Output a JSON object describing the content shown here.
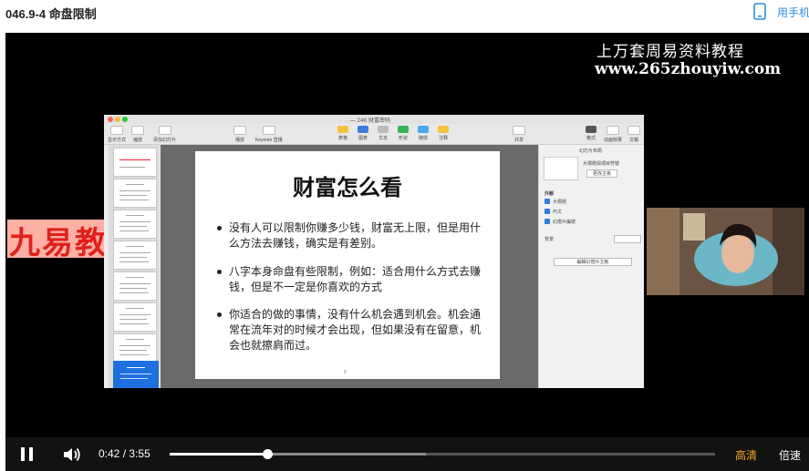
{
  "header": {
    "title": "046.9-4 命盘限制",
    "phone_label": "用手机"
  },
  "watermark": {
    "line1": "上万套周易资料教程",
    "line2": "www.265zhouyiw.com",
    "left_brand": "九易教程"
  },
  "keynote": {
    "window_title": "— 24K 财富密码",
    "toolbar": [
      "显示方式",
      "缩放",
      "添加幻灯片",
      "播放",
      "Keynote 直播",
      "表格",
      "图表",
      "文本",
      "形状",
      "媒体",
      "注释",
      "共享",
      "格式",
      "动画效果",
      "文稿"
    ],
    "slide": {
      "title": "财富怎么看",
      "bullets": [
        "没有人可以限制你赚多少钱，财富无上限，但是用什么方法去赚钱，确实是有差别。",
        "八字本身命盘有些限制，例如：适合用什么方式去赚钱，但是不一定是你喜欢的方式",
        "你适合的做的事情，没有什么机会遇到机会。机会通常在流年对的时候才会出现，但如果没有在留意，机会也就擦肩而过。"
      ],
      "page_number": "8"
    },
    "inspector": {
      "header": "幻灯片布局",
      "layout_name": "大標題與項目符號",
      "change_master": "更改主板",
      "section": "外観",
      "options": [
        "大標題",
        "內文",
        "幻燈片編號"
      ],
      "background": "背景",
      "edit_master": "編輯幻燈片主板"
    }
  },
  "player": {
    "current_time": "0:42",
    "separator": "/",
    "duration": "3:55",
    "progress_fraction": 0.1787,
    "buffered_fraction": 0.47,
    "quality_label": "高清",
    "speed_label": "倍速",
    "accent_color": "#f5a623"
  }
}
